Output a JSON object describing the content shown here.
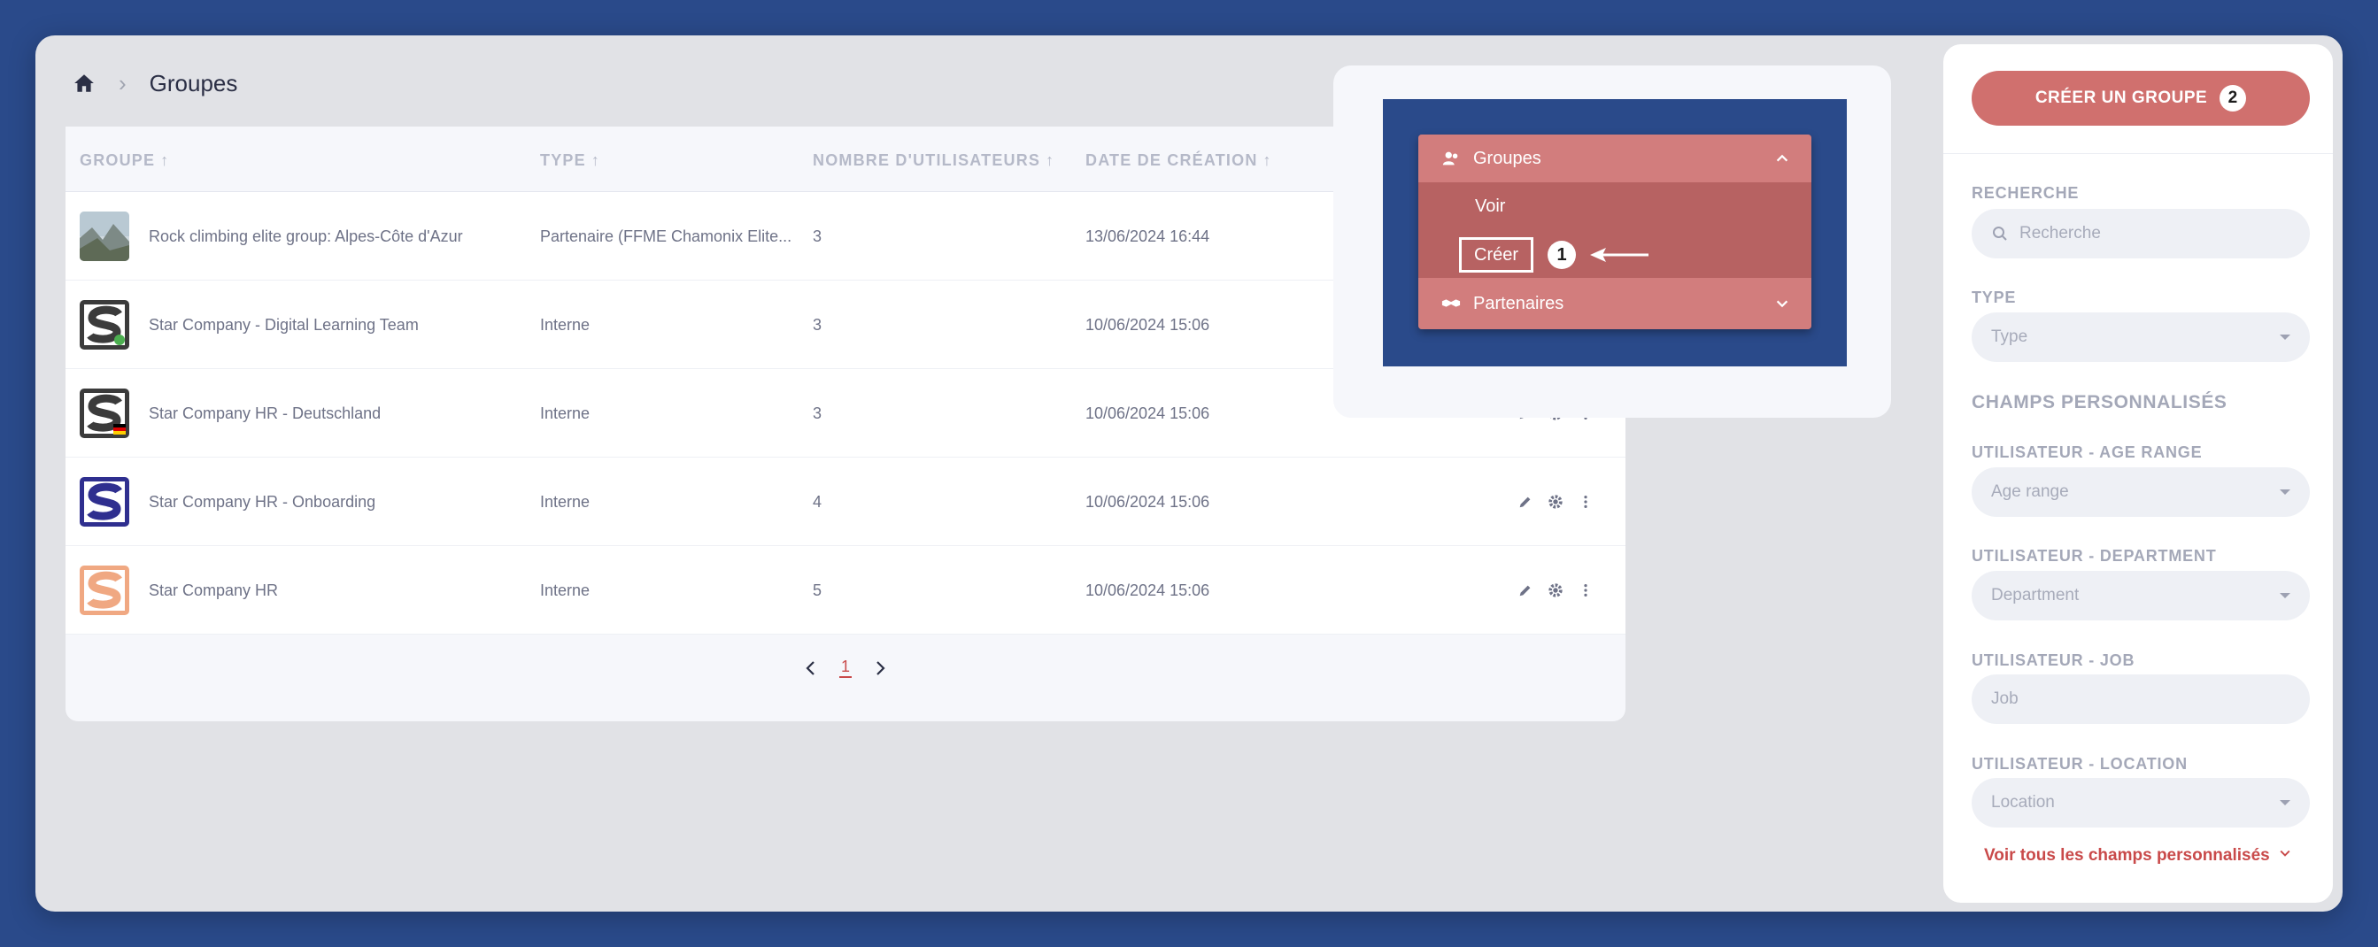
{
  "breadcrumb": {
    "home_icon": "home-icon",
    "separator": "›",
    "title": "Groupes"
  },
  "table": {
    "columns": [
      {
        "label": "GROUPE",
        "sort": "↑"
      },
      {
        "label": "TYPE",
        "sort": "↑"
      },
      {
        "label": "NOMBRE D'UTILISATEURS",
        "sort": "↑"
      },
      {
        "label": "DATE DE CRÉATION",
        "sort": "↑"
      }
    ],
    "rows": [
      {
        "name": "Rock climbing elite group: Alpes-Côte d'Azur",
        "type": "Partenaire (FFME Chamonix Elite...",
        "users": "3",
        "date": "13/06/2024 16:44",
        "avatar": "mountain-photo"
      },
      {
        "name": "Star Company - Digital Learning Team",
        "type": "Interne",
        "users": "3",
        "date": "10/06/2024 15:06",
        "avatar": "star-company-logo-dark"
      },
      {
        "name": "Star Company HR - Deutschland",
        "type": "Interne",
        "users": "3",
        "date": "10/06/2024 15:06",
        "avatar": "star-company-logo-germany"
      },
      {
        "name": "Star Company HR - Onboarding",
        "type": "Interne",
        "users": "4",
        "date": "10/06/2024 15:06",
        "avatar": "star-company-logo-blue"
      },
      {
        "name": "Star Company HR",
        "type": "Interne",
        "users": "5",
        "date": "10/06/2024 15:06",
        "avatar": "star-company-logo-orange"
      }
    ],
    "pagination": {
      "current": "1"
    }
  },
  "menu": {
    "section": "Groupes",
    "items": [
      "Voir",
      "Créer"
    ],
    "step_badge": "1",
    "footer": "Partenaires"
  },
  "panel": {
    "create_button": "CRÉER UN GROUPE",
    "create_badge": "2",
    "search_label": "RECHERCHE",
    "search_placeholder": "Recherche",
    "type_label": "TYPE",
    "type_placeholder": "Type",
    "custom_title": "CHAMPS PERSONNALISÉS",
    "age_label": "UTILISATEUR - AGE RANGE",
    "age_placeholder": "Age range",
    "dept_label": "UTILISATEUR - DEPARTMENT",
    "dept_placeholder": "Department",
    "job_label": "UTILISATEUR - JOB",
    "job_placeholder": "Job",
    "loc_label": "UTILISATEUR - LOCATION",
    "loc_placeholder": "Location",
    "more_link": "Voir tous les champs personnalisés"
  },
  "colors": {
    "accent": "#d0706e",
    "link": "#c94a4a",
    "background": "#2a4a8a"
  }
}
